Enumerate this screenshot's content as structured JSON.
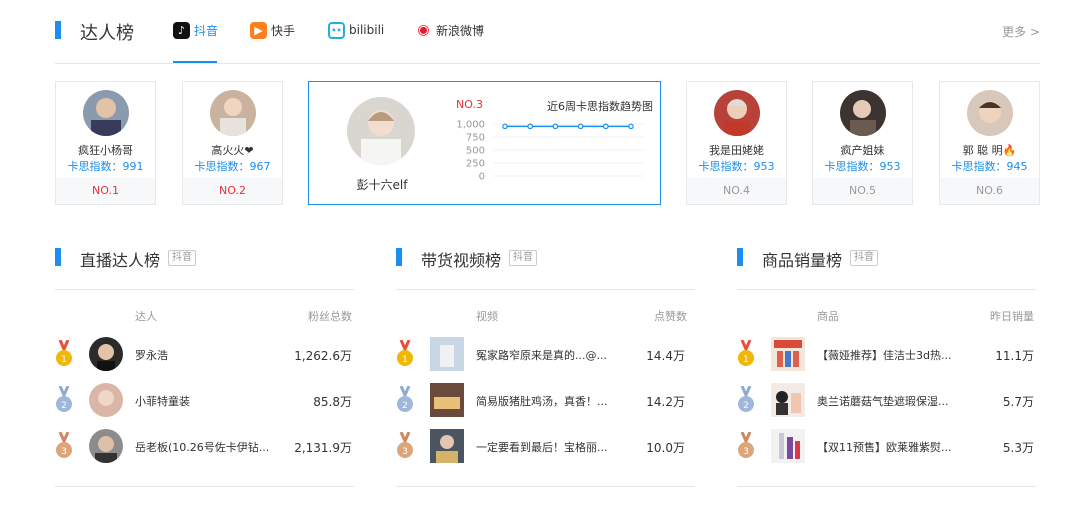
{
  "header": {
    "title": "达人榜",
    "tabs": [
      {
        "label": "抖音",
        "icon": "douyin-icon"
      },
      {
        "label": "快手",
        "icon": "kuaishou-icon"
      },
      {
        "label": "bilibili",
        "icon": "bilibili-icon"
      },
      {
        "label": "新浪微博",
        "icon": "weibo-icon"
      }
    ],
    "more": "更多 >"
  },
  "top_creators": [
    {
      "name": "疯狂小杨哥",
      "score": "卡思指数：991",
      "rank": "NO.1"
    },
    {
      "name": "高火火❤",
      "score": "卡思指数：967",
      "rank": "NO.2"
    },
    {
      "name": "我是田姥姥",
      "score": "卡思指数：953",
      "rank": "NO.4"
    },
    {
      "name": "疯产姐妹",
      "score": "卡思指数：953",
      "rank": "NO.5"
    },
    {
      "name": "郭 聪 明🔥",
      "score": "卡思指数：945",
      "rank": "NO.6"
    }
  ],
  "featured": {
    "rank": "NO.3",
    "name": "彭十六elf",
    "chart_title": "近6周卡思指数趋势图"
  },
  "chart_data": {
    "type": "line",
    "title": "近6周卡思指数趋势图",
    "y_ticks": [
      "1,000",
      "750",
      "500",
      "250",
      "0"
    ],
    "ylim": [
      0,
      1000
    ],
    "x": [
      1,
      2,
      3,
      4,
      5,
      6
    ],
    "values": [
      955,
      955,
      955,
      955,
      955,
      955
    ],
    "grid": true,
    "color": "#1b8ff0"
  },
  "sections": [
    {
      "title": "直播达人榜",
      "tag": "抖音",
      "col1": "达人",
      "col2": "粉丝总数",
      "rows": [
        {
          "name": "罗永浩",
          "value": "1,262.6万"
        },
        {
          "name": "小菲特童装",
          "value": "85.8万"
        },
        {
          "name": "岳老板(10.26号佐卡伊钻...",
          "value": "2,131.9万"
        }
      ]
    },
    {
      "title": "带货视频榜",
      "tag": "抖音",
      "col1": "视频",
      "col2": "点赞数",
      "rows": [
        {
          "name": "冤家路窄原来是真的...@...",
          "value": "14.4万"
        },
        {
          "name": "简易版猪肚鸡汤，真香！...",
          "value": "14.2万"
        },
        {
          "name": "一定要看到最后！宝格丽...",
          "value": "10.0万"
        }
      ]
    },
    {
      "title": "商品销量榜",
      "tag": "抖音",
      "col1": "商品",
      "col2": "昨日销量",
      "rows": [
        {
          "name": "【薇娅推荐】佳洁士3d热...",
          "value": "11.1万"
        },
        {
          "name": "奥兰诺蘑菇气垫遮瑕保湿...",
          "value": "5.7万"
        },
        {
          "name": "【双11预售】欧莱雅紫熨...",
          "value": "5.3万"
        }
      ]
    }
  ],
  "colors": {
    "accent": "#1b8ff0",
    "rank_red": "#e8303a",
    "gold": "#f2b705",
    "silver": "#9fb7d8",
    "bronze": "#dca57a"
  }
}
